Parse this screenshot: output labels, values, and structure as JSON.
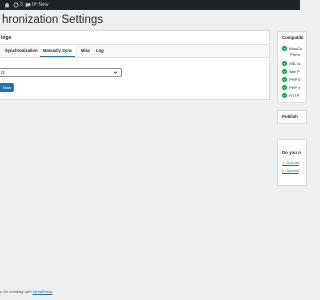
{
  "adminbar": {
    "updates_count": "3",
    "comments_count": "0",
    "new_label": "New"
  },
  "page": {
    "title": "hronization Settings"
  },
  "panel": {
    "heading": "ings",
    "tabs": [
      {
        "label": "Synchronization"
      },
      {
        "label": "Manually Sync"
      },
      {
        "label": "Misc"
      },
      {
        "label": "Log"
      }
    ],
    "select_value": "t2",
    "button_label": "Now"
  },
  "sidebar": {
    "compat": {
      "title": "Compatibi",
      "items": [
        {
          "label": "WooCo",
          "sub": "\"Perm"
        },
        {
          "label": "SSL is"
        },
        {
          "label": "Site P"
        },
        {
          "label": "PHP E"
        },
        {
          "label": "PHP c"
        },
        {
          "label": "HTTP"
        }
      ]
    },
    "publish": {
      "title": "Publish"
    },
    "support": {
      "title": "Do you n",
      "links": [
        "1. Docum",
        "2. Submit"
      ]
    }
  },
  "footer": {
    "prefix": "u for creating with ",
    "link": "WordPress",
    "suffix": "."
  },
  "colors": {
    "accent": "#2271b1",
    "adminbar": "#1d2327",
    "success": "#00a32a",
    "background": "#f0f0f1"
  }
}
